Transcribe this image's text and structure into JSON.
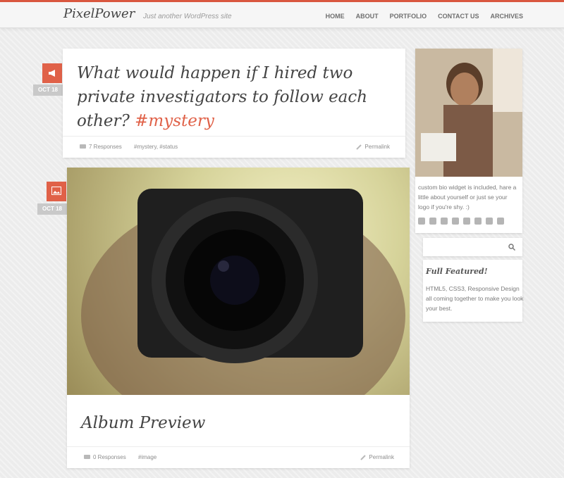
{
  "header": {
    "logo": "PixelPower",
    "tagline": "Just another WordPress site",
    "nav": [
      "HOME",
      "ABOUT",
      "PORTFOLIO",
      "CONTACT US",
      "ARCHIVES"
    ]
  },
  "posts": [
    {
      "date": "OCT 18",
      "icon": "megaphone-icon",
      "title": "What would happen if I hired two private investigators to follow each other?",
      "hashtag": "#mystery",
      "responses": "7 Responses",
      "tags": "#mystery, #status",
      "permalink": "Permalink"
    },
    {
      "date": "OCT 18",
      "icon": "image-icon",
      "title": "Album Preview",
      "responses": "0 Responses",
      "tags": "#image",
      "permalink": "Permalink"
    }
  ],
  "sidebar": {
    "bio": "custom bio widget is included, hare a little about yourself or just se your logo if you're shy. :)",
    "social_icons": [
      "vimeo-icon",
      "youtube-icon",
      "linkedin-icon",
      "trash-icon",
      "flickr-icon",
      "skype-icon",
      "dribbble-icon",
      "twitter-icon"
    ],
    "search_placeholder": "",
    "feature_title": "Full Featured!",
    "feature_body": "HTML5, CSS3, Responsive Design all coming together to make you look your best."
  },
  "colors": {
    "accent": "#e06148",
    "date_badge": "#c9c9c9",
    "background": "#ececec"
  }
}
